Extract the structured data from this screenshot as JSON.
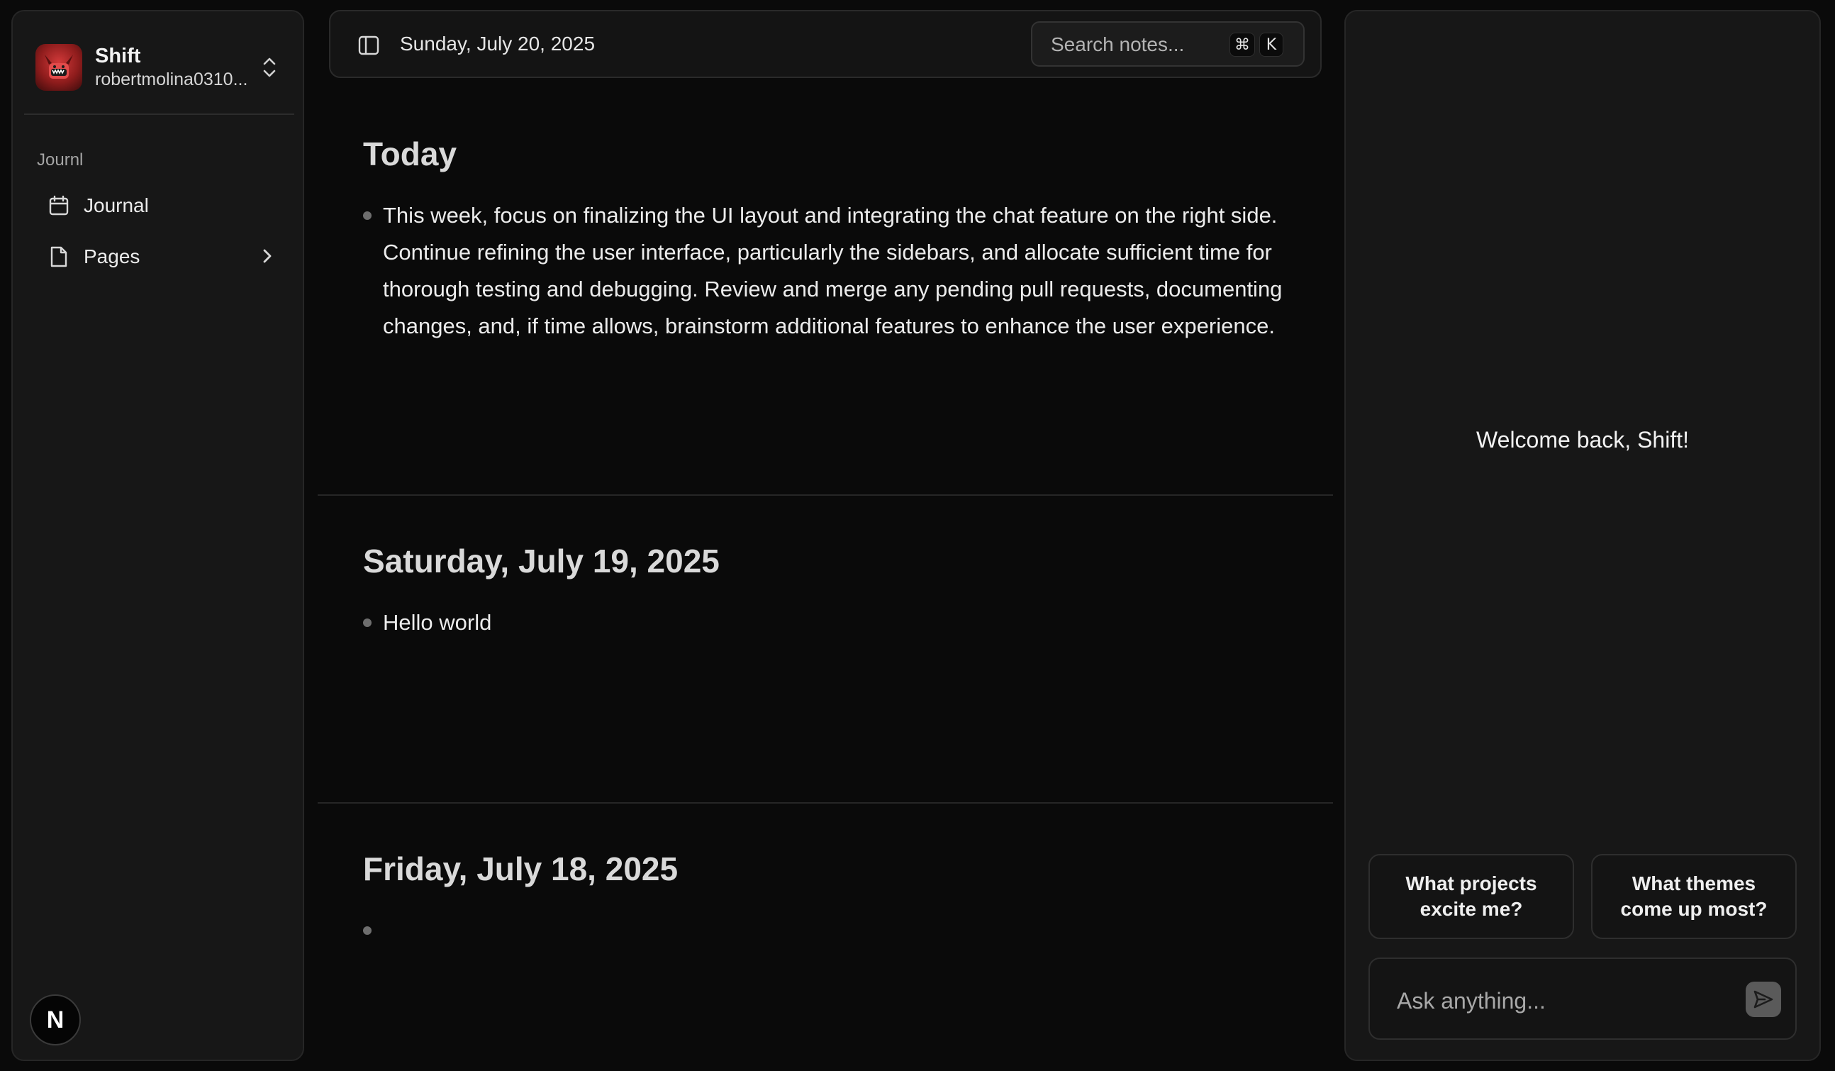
{
  "sidebar": {
    "workspace": {
      "name": "Shift",
      "email": "robertmolina0310..."
    },
    "group_label": "Journl",
    "items": [
      {
        "label": "Journal",
        "icon": "calendar-icon"
      },
      {
        "label": "Pages",
        "icon": "file-icon"
      }
    ],
    "footer_badge": "N"
  },
  "topbar": {
    "date": "Sunday, July 20, 2025",
    "search": {
      "placeholder": "Search notes...",
      "shortcut_mod": "⌘",
      "shortcut_key": "K"
    }
  },
  "journal": {
    "entries": [
      {
        "title": "Today",
        "bullets": [
          "This week, focus on finalizing the UI layout and integrating the chat feature on the right side. Continue refining the user interface, particularly the sidebars, and allocate sufficient time for thorough testing and debugging. Review and merge any pending pull requests, documenting changes, and, if time allows, brainstorm additional features to enhance the user experience."
        ]
      },
      {
        "title": "Saturday, July 19, 2025",
        "bullets": [
          "Hello world"
        ]
      },
      {
        "title": "Friday, July 18, 2025",
        "bullets": [
          ""
        ]
      }
    ]
  },
  "chat": {
    "welcome": "Welcome back, Shift!",
    "suggestions": [
      "What projects excite me?",
      "What themes come up most?"
    ],
    "input_placeholder": "Ask anything..."
  },
  "colors": {
    "background": "#0a0a0a",
    "panel": "#171717",
    "border": "#262626",
    "accent_red": "#c62f2f"
  }
}
